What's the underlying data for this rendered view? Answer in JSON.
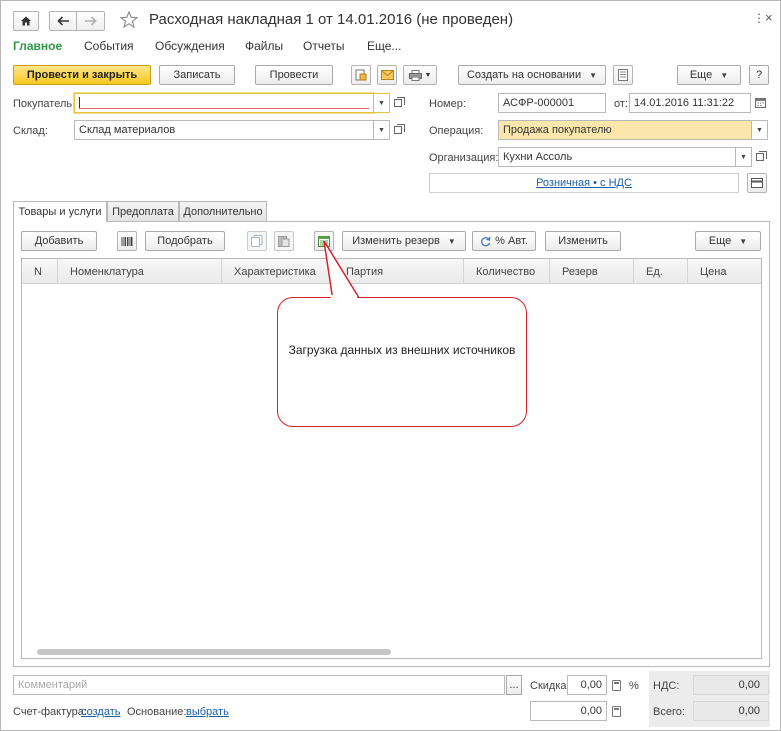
{
  "window": {
    "title": "Расходная накладная 1 от 14.01.2016 (не проведен)"
  },
  "nav": {
    "items": [
      "Главное",
      "События",
      "Обсуждения",
      "Файлы",
      "Отчеты",
      "Еще..."
    ],
    "active_color": "#2c9a43"
  },
  "toolbar": {
    "post_close": "Провести и закрыть",
    "save": "Записать",
    "post": "Провести",
    "create_based": "Создать на основании",
    "more": "Еще",
    "help": "?"
  },
  "form": {
    "buyer_label": "Покупатель:",
    "buyer_value": "",
    "warehouse_label": "Склад:",
    "warehouse_value": "Склад материалов",
    "number_label": "Номер:",
    "number_value": "АСФР-000001",
    "from_label": "от:",
    "date_value": "14.01.2016 11:31:22",
    "operation_label": "Операция:",
    "operation_value": "Продажа покупателю",
    "org_label": "Организация:",
    "org_value": "Кухни Ассоль",
    "price_type_link": "Розничная • с НДС"
  },
  "tabs": [
    "Товары и услуги",
    "Предоплата",
    "Дополнительно"
  ],
  "table_toolbar": {
    "add": "Добавить",
    "pick": "Подобрать",
    "change_reserve": "Изменить резерв",
    "auto_percent": "% Авт.",
    "change": "Изменить",
    "more": "Еще"
  },
  "table": {
    "columns": [
      "N",
      "Номенклатура",
      "Характеристика",
      "Партия",
      "Количество",
      "Резерв",
      "Ед.",
      "Цена"
    ]
  },
  "callout": {
    "text": "Загрузка данных из внешних источников"
  },
  "footer": {
    "comment_placeholder": "Комментарий",
    "more_btn": "...",
    "discount_label": "Скидка:",
    "discount_value": "0,00",
    "percent": "%",
    "vat_label": "НДС:",
    "vat_value": "0,00",
    "invoice_label": "Счет-фактура:",
    "invoice_link": "создать",
    "basis_label": "Основание:",
    "basis_link": "выбрать",
    "sum_value": "0,00",
    "total_label": "Всего:",
    "total_value": "0,00"
  }
}
